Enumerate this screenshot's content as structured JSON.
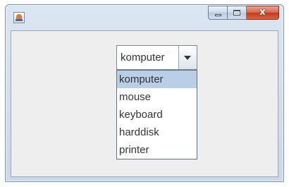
{
  "window": {
    "title": "",
    "close_label": "x"
  },
  "combo": {
    "selected": "komputer"
  },
  "dropdown": {
    "items": [
      {
        "label": "komputer",
        "selected": true
      },
      {
        "label": "mouse",
        "selected": false
      },
      {
        "label": "keyboard",
        "selected": false
      },
      {
        "label": "harddisk",
        "selected": false
      },
      {
        "label": "printer",
        "selected": false
      }
    ]
  },
  "colors": {
    "selection": "#b8cfe5",
    "close_button": "#c4381d",
    "titlebar": "#c9d8ea",
    "content_background": "#eeeeee"
  },
  "icons": {
    "app": "java-app-icon",
    "minimize": "minimize-icon",
    "maximize": "maximize-icon",
    "close": "close-icon",
    "dropdown": "chevron-down-icon"
  }
}
